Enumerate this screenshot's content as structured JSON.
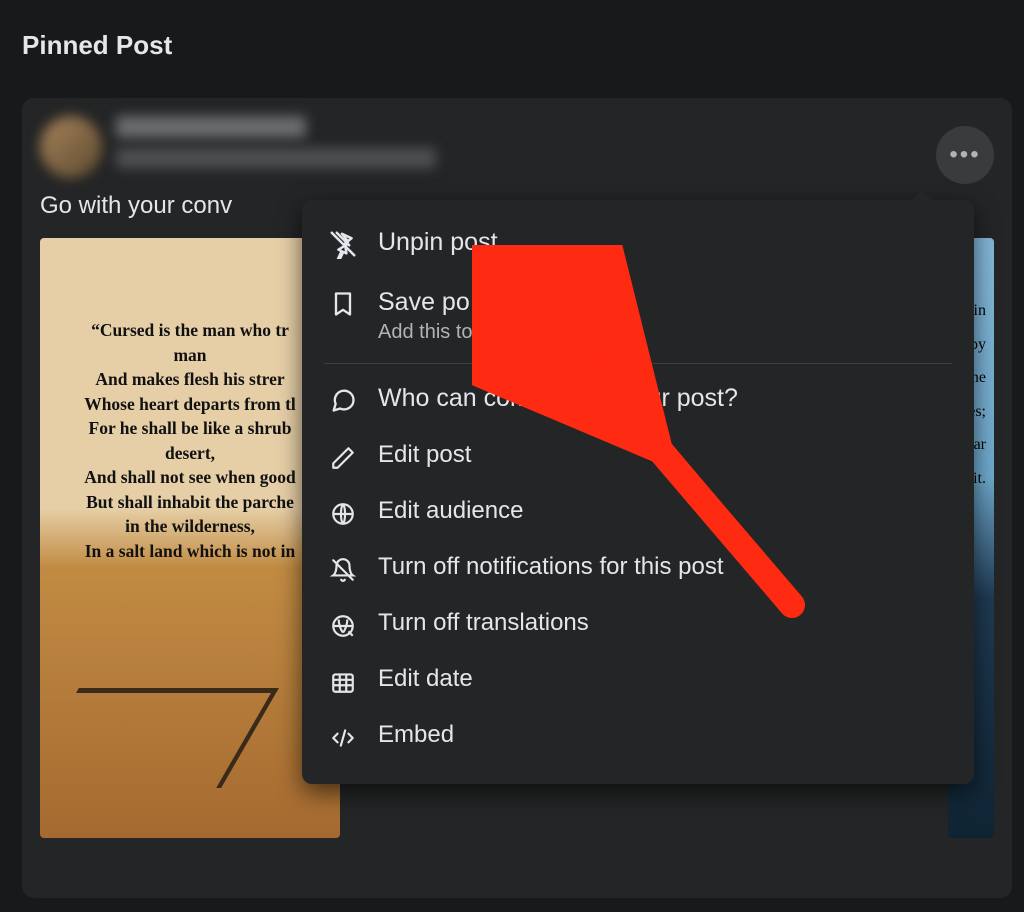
{
  "section_title": "Pinned Post",
  "post": {
    "text_preview": "Go with your conv",
    "image1_text": "“Cursed is the man who tr\nman\nAnd makes flesh his strer\nWhose heart departs from tl\nFor he shall be like a shrub\ndesert,\nAnd shall not see when good\nBut shall inhabit the parche\nin the wilderness,\nIn a salt land which is not in",
    "image2_lines": [
      "in",
      "d by",
      "he",
      "ies;",
      "ear",
      "iit."
    ]
  },
  "menu": {
    "unpin": "Unpin post",
    "save": {
      "label": "Save po",
      "sub": "Add this to yo      aved items."
    },
    "who_comment": "Who can commen    on your post?",
    "edit_post": "Edit post",
    "edit_audience": "Edit audience",
    "turn_off_notifications": "Turn off notifications for this post",
    "turn_off_translations": "Turn off translations",
    "edit_date": "Edit date",
    "embed": "Embed"
  }
}
